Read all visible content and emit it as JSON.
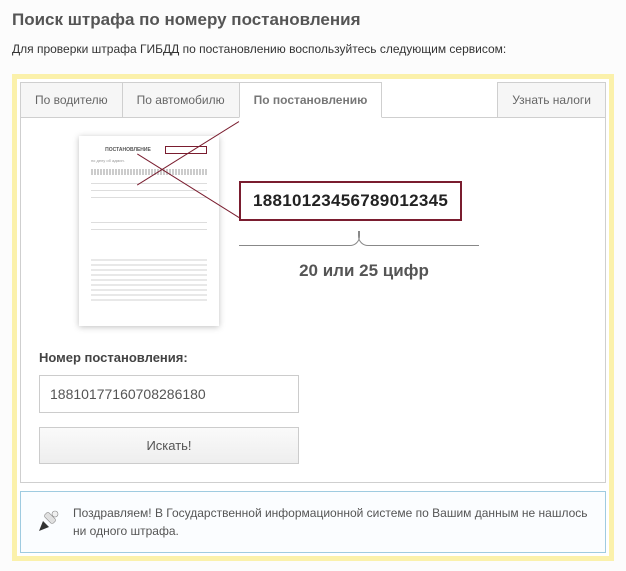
{
  "page": {
    "title": "Поиск штрафа по номеру постановления",
    "description": "Для проверки штрафа ГИБДД по постановлению воспользуйтесь следующим сервисом:"
  },
  "tabs": {
    "driver": "По водителю",
    "vehicle": "По автомобилю",
    "resolution": "По постановлению",
    "taxes": "Узнать налоги"
  },
  "illustration": {
    "doc_title": "ПОСТАНОВЛЕНИЕ",
    "example_number": "18810123456789012345",
    "hint": "20 или 25 цифр"
  },
  "form": {
    "label": "Номер постановления:",
    "input_value": "18810177160708286180",
    "search_button": "Искать!"
  },
  "result": {
    "message": "Поздравляем! В Государственной информационной системе по Вашим данным не нашлось ни одного штрафа."
  }
}
